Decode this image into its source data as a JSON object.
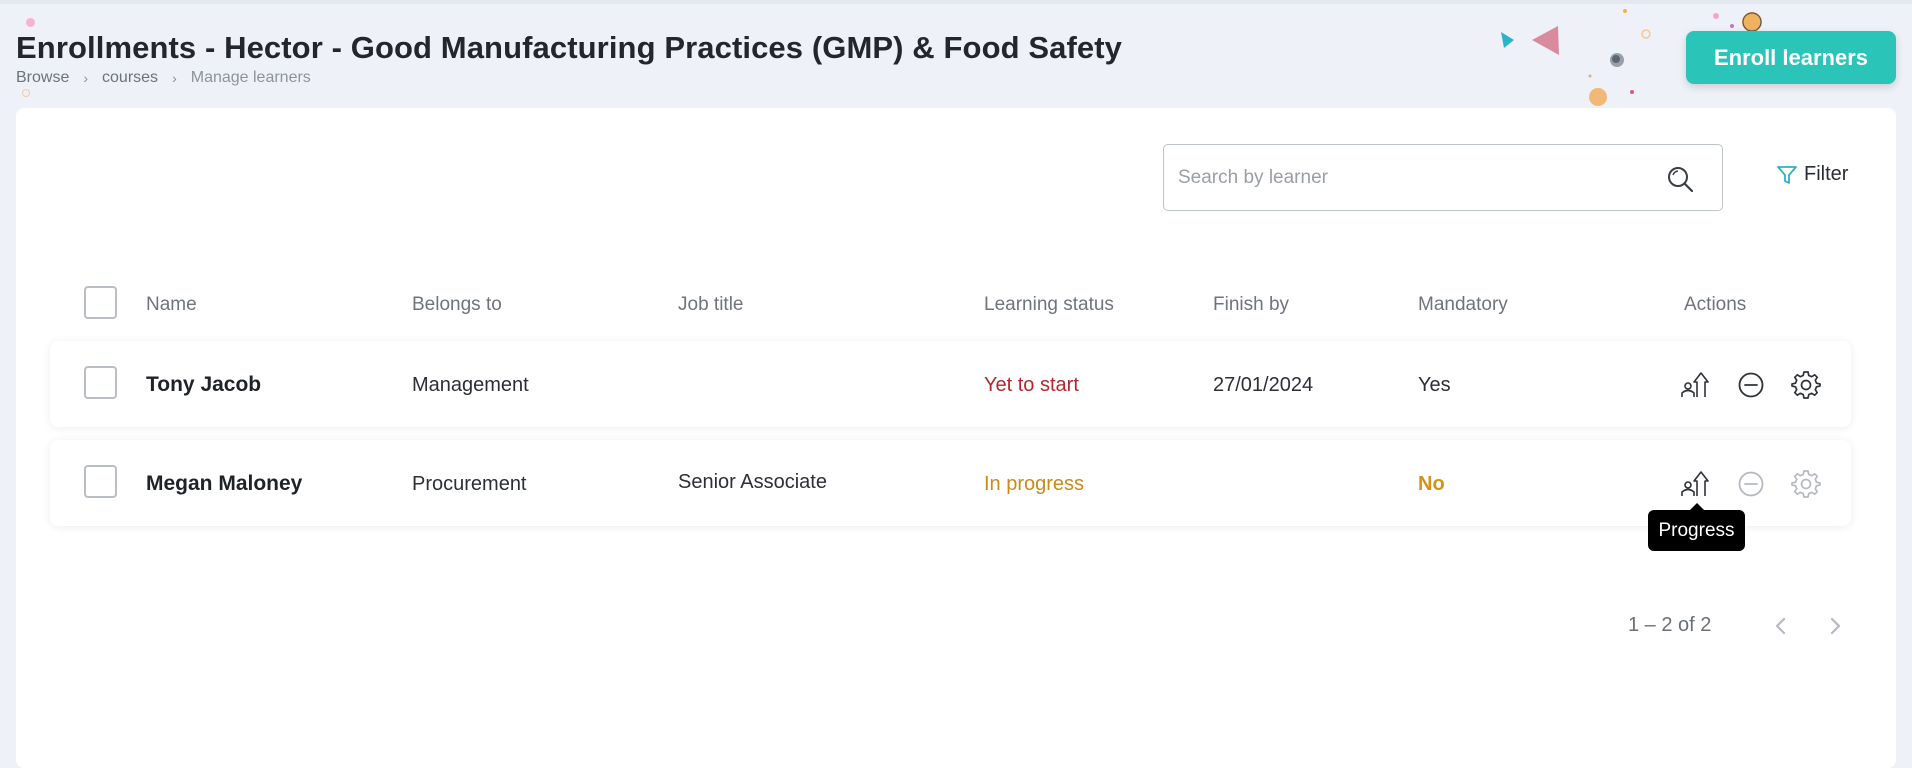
{
  "header": {
    "title": "Enrollments - Hector - Good Manufacturing Practices (GMP) & Food Safety",
    "breadcrumb": [
      "Browse",
      "courses",
      "Manage learners"
    ],
    "enroll_label": "Enroll learners"
  },
  "toolbar": {
    "search_placeholder": "Search by learner",
    "filter_label": "Filter"
  },
  "table": {
    "columns": [
      "Name",
      "Belongs to",
      "Job title",
      "Learning status",
      "Finish by",
      "Mandatory",
      "Actions"
    ],
    "rows": [
      {
        "name": "Tony Jacob",
        "belongs_to": "Management",
        "job_title": "",
        "learning_status": "Yet to start",
        "finish_by": "27/01/2024",
        "mandatory": "Yes"
      },
      {
        "name": "Megan Maloney",
        "belongs_to": "Procurement",
        "job_title": "Senior Associate",
        "learning_status": "In progress",
        "finish_by": "",
        "mandatory": "No"
      }
    ],
    "actions": [
      "progress-icon",
      "remove-icon",
      "settings-icon"
    ]
  },
  "tooltip": {
    "text": "Progress"
  },
  "pagination": {
    "range": "1 – 2 of 2"
  },
  "colors": {
    "accent": "#2ac4b8",
    "status_yet_to_start": "#b3282d",
    "status_in_progress": "#c98a1c",
    "mandatory_no": "#d49216"
  }
}
